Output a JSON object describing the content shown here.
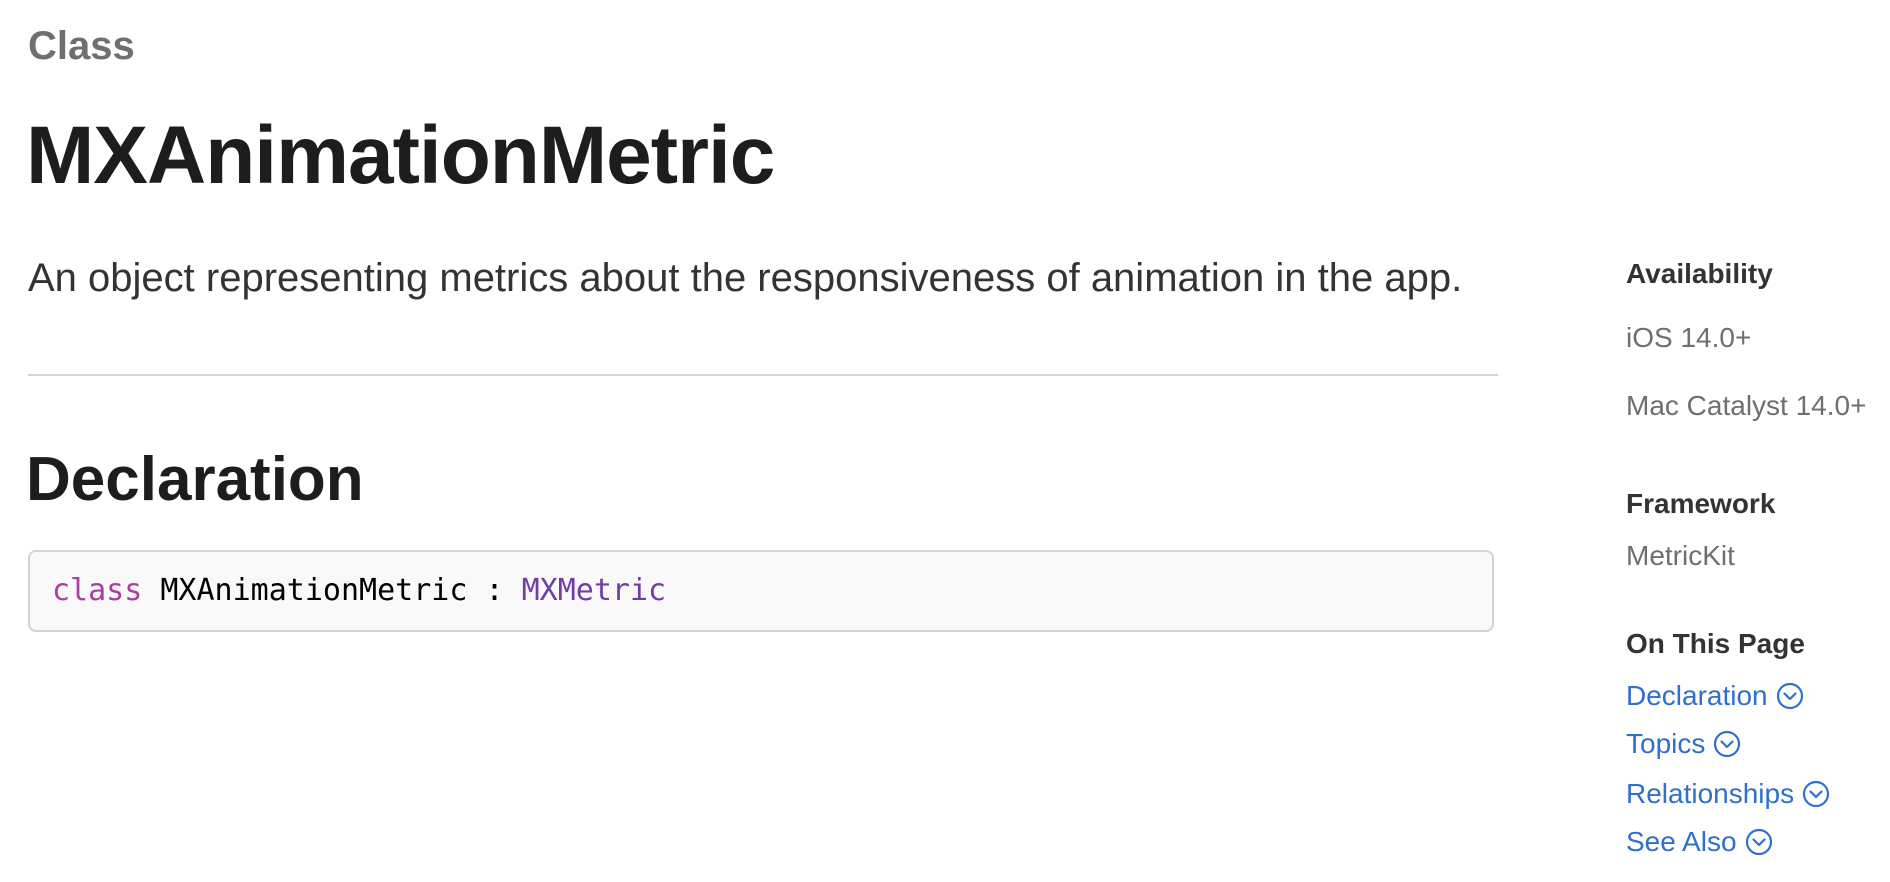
{
  "page": {
    "eyebrow": "Class",
    "title": "MXAnimationMetric",
    "abstract": "An object representing metrics about the responsiveness of animation in the app."
  },
  "declaration": {
    "heading": "Declaration",
    "code": {
      "keyword": "class",
      "name": " MXAnimationMetric : ",
      "superclass": "MXMetric"
    }
  },
  "sidebar": {
    "availability": {
      "label": "Availability",
      "platforms": [
        "iOS 14.0+",
        "Mac Catalyst 14.0+"
      ]
    },
    "framework": {
      "label": "Framework",
      "value": "MetricKit"
    },
    "on_this_page": {
      "label": "On This Page",
      "links": [
        {
          "label": "Declaration",
          "icon": "chevron-down-circle-icon"
        },
        {
          "label": "Topics",
          "icon": "chevron-down-circle-icon"
        },
        {
          "label": "Relationships",
          "icon": "chevron-down-circle-icon"
        },
        {
          "label": "See Also",
          "icon": "chevron-down-circle-icon"
        }
      ]
    }
  },
  "colors": {
    "link": "#2f6fce",
    "keyword": "#ad3da4",
    "type": "#703daa",
    "eyebrow": "#6e6e73"
  }
}
